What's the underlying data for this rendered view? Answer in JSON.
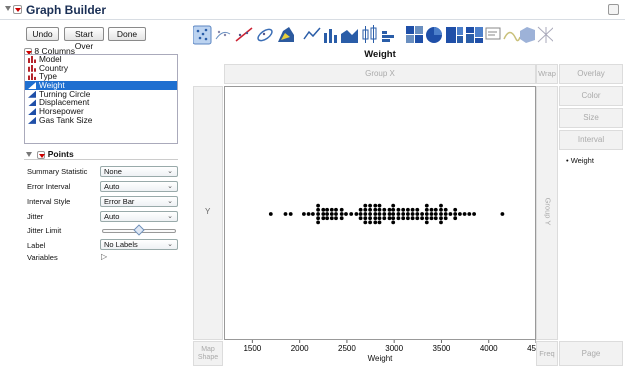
{
  "window": {
    "title": "Graph Builder"
  },
  "buttons": {
    "undo": "Undo",
    "start_over": "Start Over",
    "done": "Done"
  },
  "columns": {
    "header": "8 Columns",
    "items": [
      {
        "label": "Model",
        "type": "nominal"
      },
      {
        "label": "Country",
        "type": "nominal"
      },
      {
        "label": "Type",
        "type": "nominal"
      },
      {
        "label": "Weight",
        "type": "continuous",
        "selected": true
      },
      {
        "label": "Turning Circle",
        "type": "continuous"
      },
      {
        "label": "Displacement",
        "type": "continuous"
      },
      {
        "label": "Horsepower",
        "type": "continuous"
      },
      {
        "label": "Gas Tank Size",
        "type": "continuous"
      }
    ]
  },
  "points_panel": {
    "header": "Points",
    "summary_statistic": {
      "label": "Summary Statistic",
      "value": "None"
    },
    "error_interval": {
      "label": "Error Interval",
      "value": "Auto"
    },
    "interval_style": {
      "label": "Interval Style",
      "value": "Error Bar"
    },
    "jitter": {
      "label": "Jitter",
      "value": "Auto"
    },
    "jitter_limit": {
      "label": "Jitter Limit",
      "level": 0.5
    },
    "label": {
      "label": "Label",
      "value": "No Labels"
    },
    "variables": {
      "label": "Variables"
    }
  },
  "zones": {
    "group_x": "Group X",
    "group_y": "Group Y",
    "wrap": "Wrap",
    "overlay": "Overlay",
    "color": "Color",
    "size": "Size",
    "interval": "Interval",
    "y": "Y",
    "map_shape": "Map Shape",
    "freq": "Freq",
    "page": "Page"
  },
  "legend": {
    "item": "Weight"
  },
  "chart_data": {
    "type": "scatter",
    "title": "Weight",
    "xlabel": "Weight",
    "ylabel": "",
    "xlim": [
      1200,
      4500
    ],
    "x_ticks": [
      1500,
      2000,
      2500,
      3000,
      3500,
      4000,
      4500
    ],
    "points": [
      [
        1695,
        0
      ],
      [
        1850,
        0
      ],
      [
        1905,
        0
      ],
      [
        2045,
        0
      ],
      [
        2095,
        0
      ],
      [
        2140,
        0
      ],
      [
        2195,
        0
      ],
      [
        2195,
        1
      ],
      [
        2195,
        -1
      ],
      [
        2195,
        2
      ],
      [
        2195,
        -2
      ],
      [
        2250,
        0
      ],
      [
        2250,
        1
      ],
      [
        2250,
        -1
      ],
      [
        2290,
        0
      ],
      [
        2290,
        1
      ],
      [
        2290,
        -1
      ],
      [
        2340,
        0
      ],
      [
        2340,
        1
      ],
      [
        2340,
        -1
      ],
      [
        2385,
        0
      ],
      [
        2385,
        1
      ],
      [
        2385,
        -1
      ],
      [
        2445,
        0
      ],
      [
        2445,
        1
      ],
      [
        2445,
        -1
      ],
      [
        2490,
        0
      ],
      [
        2545,
        0
      ],
      [
        2600,
        0
      ],
      [
        2645,
        0
      ],
      [
        2645,
        1
      ],
      [
        2645,
        -1
      ],
      [
        2695,
        0
      ],
      [
        2695,
        1
      ],
      [
        2695,
        -1
      ],
      [
        2695,
        2
      ],
      [
        2695,
        -2
      ],
      [
        2745,
        0
      ],
      [
        2745,
        1
      ],
      [
        2745,
        -1
      ],
      [
        2745,
        2
      ],
      [
        2745,
        -2
      ],
      [
        2800,
        0
      ],
      [
        2800,
        1
      ],
      [
        2800,
        -1
      ],
      [
        2800,
        2
      ],
      [
        2800,
        -2
      ],
      [
        2845,
        0
      ],
      [
        2845,
        1
      ],
      [
        2845,
        -1
      ],
      [
        2845,
        2
      ],
      [
        2845,
        -2
      ],
      [
        2895,
        0
      ],
      [
        2895,
        1
      ],
      [
        2895,
        -1
      ],
      [
        2950,
        0
      ],
      [
        2950,
        1
      ],
      [
        2950,
        -1
      ],
      [
        2990,
        0
      ],
      [
        2990,
        1
      ],
      [
        2990,
        -1
      ],
      [
        2990,
        2
      ],
      [
        2990,
        -2
      ],
      [
        3045,
        0
      ],
      [
        3045,
        1
      ],
      [
        3045,
        -1
      ],
      [
        3095,
        0
      ],
      [
        3095,
        1
      ],
      [
        3095,
        -1
      ],
      [
        3145,
        0
      ],
      [
        3145,
        1
      ],
      [
        3145,
        -1
      ],
      [
        3195,
        0
      ],
      [
        3195,
        1
      ],
      [
        3195,
        -1
      ],
      [
        3245,
        0
      ],
      [
        3245,
        1
      ],
      [
        3245,
        -1
      ],
      [
        3295,
        0
      ],
      [
        3295,
        1
      ],
      [
        3345,
        0
      ],
      [
        3345,
        1
      ],
      [
        3345,
        -1
      ],
      [
        3345,
        2
      ],
      [
        3345,
        -2
      ],
      [
        3395,
        0
      ],
      [
        3395,
        1
      ],
      [
        3395,
        -1
      ],
      [
        3440,
        0
      ],
      [
        3440,
        1
      ],
      [
        3440,
        -1
      ],
      [
        3495,
        0
      ],
      [
        3495,
        1
      ],
      [
        3495,
        -1
      ],
      [
        3495,
        2
      ],
      [
        3495,
        -2
      ],
      [
        3545,
        0
      ],
      [
        3545,
        1
      ],
      [
        3545,
        -1
      ],
      [
        3595,
        0
      ],
      [
        3645,
        0
      ],
      [
        3645,
        1
      ],
      [
        3645,
        -1
      ],
      [
        3695,
        0
      ],
      [
        3745,
        0
      ],
      [
        3795,
        0
      ],
      [
        3845,
        0
      ],
      [
        4145,
        0
      ]
    ]
  },
  "colors": {
    "selection": "#1f6fd0",
    "title": "#1a2f55",
    "dot": "#000000"
  }
}
